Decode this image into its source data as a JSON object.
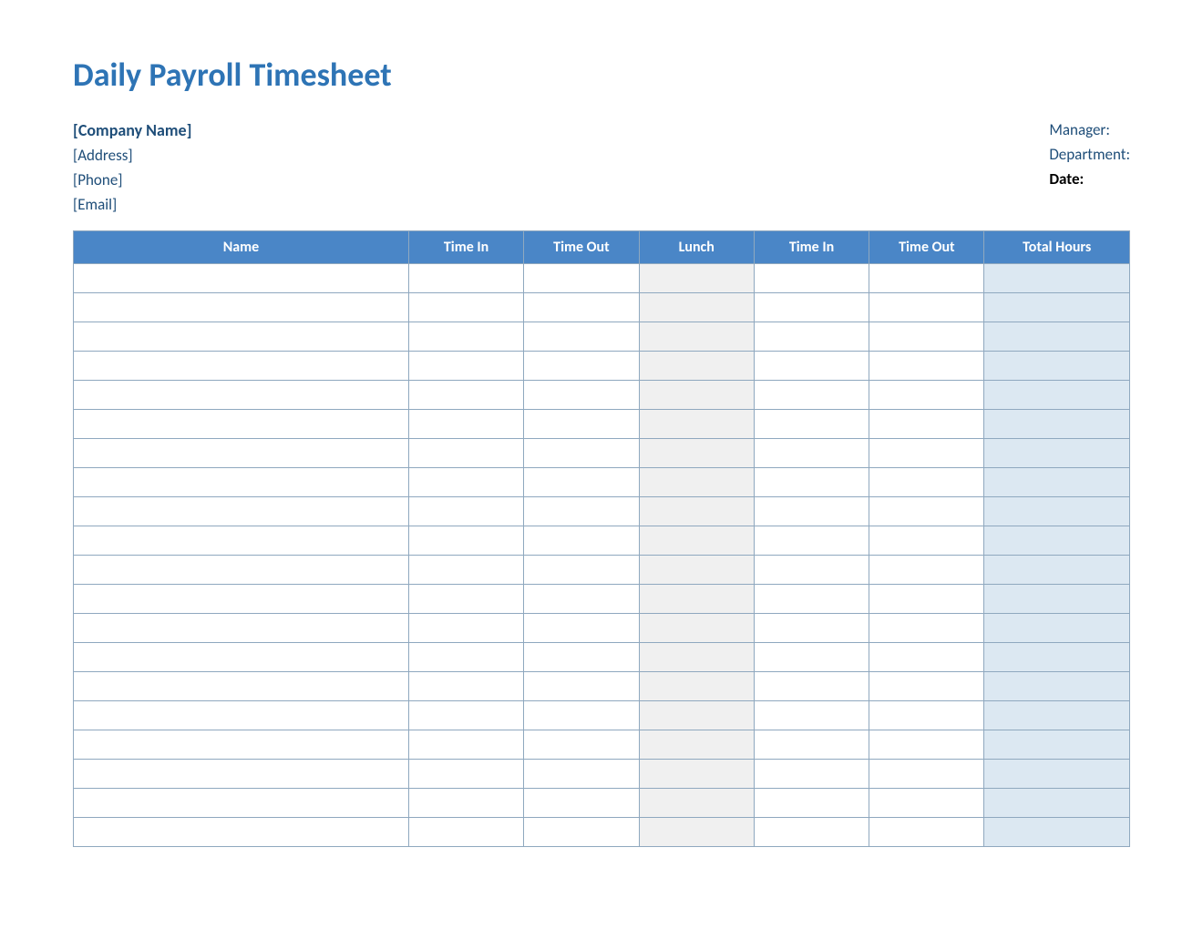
{
  "title": "Daily Payroll Timesheet",
  "company": {
    "name": "[Company Name]",
    "address": "[Address]",
    "phone": "[Phone]",
    "email": "[Email]"
  },
  "meta": {
    "manager_label": "Manager:",
    "department_label": "Department:",
    "date_label": "Date:"
  },
  "columns": {
    "name": "Name",
    "time_in_1": "Time In",
    "time_out_1": "Time Out",
    "lunch": "Lunch",
    "time_in_2": "Time In",
    "time_out_2": "Time Out",
    "total_hours": "Total Hours"
  },
  "row_count": 20,
  "colors": {
    "header_bg": "#4a86c7",
    "title": "#2e74b5",
    "meta_text": "#1f4e79",
    "lunch_bg": "#f0f0f0",
    "total_bg": "#dce8f2",
    "border": "#8fa8bf"
  }
}
